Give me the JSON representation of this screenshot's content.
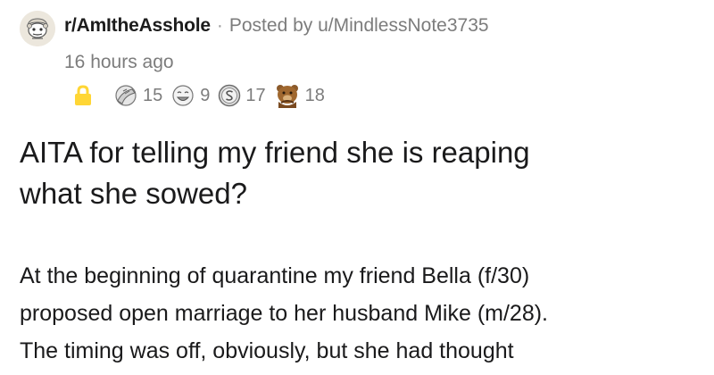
{
  "post": {
    "subreddit": "r/AmItheAsshole",
    "separator": "·",
    "posted_by": "Posted by u/MindlessNote3735",
    "time_ago": "16 hours ago",
    "locked": true,
    "awards": [
      {
        "icon": "facepalm-award-icon",
        "count": "15"
      },
      {
        "icon": "laughing-face-award-icon",
        "count": "9"
      },
      {
        "icon": "silver-coin-award-icon",
        "count": "17"
      },
      {
        "icon": "bear-award-icon",
        "count": "18"
      }
    ],
    "title_lines": [
      "AITA for telling my friend she is reaping",
      "what she sowed?"
    ],
    "body_lines": [
      "At the beginning of quarantine my friend Bella (f/30)",
      "proposed open marriage to her husband Mike (m/28).",
      "The timing was off, obviously, but she had thought"
    ]
  },
  "colors": {
    "lock": "#ffd635",
    "meta_gray": "#7c7c7c",
    "text": "#1a1a1b"
  }
}
